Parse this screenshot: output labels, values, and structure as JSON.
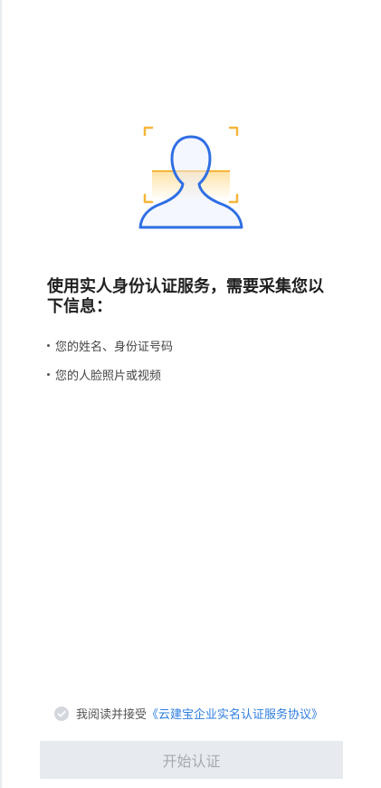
{
  "title": "使用实人身份认证服务，需要采集您以下信息：",
  "info_items": [
    "您的姓名、身份证号码",
    "您的人脸照片或视频"
  ],
  "agreement": {
    "prefix": "我阅读并接受",
    "link_text": "《云建宝企业实名认证服务协议》"
  },
  "start_button_label": "开始认证",
  "colors": {
    "accent": "#2f7ddf",
    "frame_corner": "#f6b63a",
    "button_bg": "#e7eaee",
    "button_text": "#a5abb3"
  },
  "icons": [
    "face-scan-icon",
    "check-circle-icon"
  ]
}
